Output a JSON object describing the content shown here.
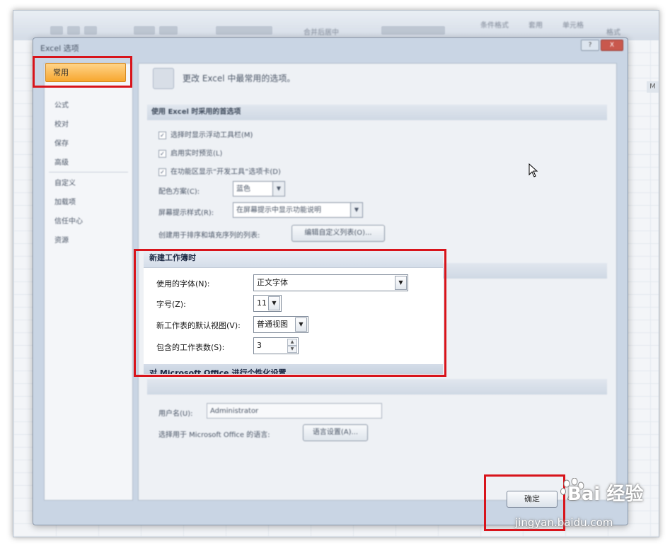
{
  "window": {
    "title": "Excel 选项",
    "minimize_label": "?",
    "close_label": "X"
  },
  "ribbon": {
    "buttons": [
      "条件格式",
      "套用",
      "单元格",
      "格式",
      "合并后居中"
    ],
    "column_header": "M"
  },
  "sidebar": {
    "selected": "常用",
    "items": [
      {
        "label": "公式"
      },
      {
        "label": "校对"
      },
      {
        "label": "保存"
      },
      {
        "label": "高级"
      },
      {
        "label": "自定义"
      },
      {
        "label": "加载项"
      },
      {
        "label": "信任中心"
      },
      {
        "label": "资源"
      }
    ]
  },
  "main": {
    "header": "更改 Excel 中最常用的选项。",
    "section_top": {
      "title": "使用 Excel 时采用的首选项",
      "checkboxes": [
        {
          "label": "选择时显示浮动工具栏(M)",
          "checked": true
        },
        {
          "label": "启用实时预览(L)",
          "checked": true
        },
        {
          "label": "在功能区显示“开发工具”选项卡(D)",
          "checked": true
        }
      ],
      "color_scheme_label": "配色方案(C):",
      "color_scheme_value": "蓝色",
      "screentip_label": "屏幕提示样式(R):",
      "screentip_value": "在屏幕提示中显示功能说明",
      "custom_lists_label": "创建用于排序和填充序列的列表:",
      "custom_lists_button": "编辑自定义列表(O)..."
    },
    "new_workbook": {
      "title": "新建工作簿时",
      "font_label": "使用的字体(N):",
      "font_value": "正文字体",
      "size_label": "字号(Z):",
      "size_value": "11",
      "view_label": "新工作表的默认视图(V):",
      "view_value": "普通视图",
      "sheets_label": "包含的工作表数(S):",
      "sheets_value": "3"
    },
    "personalize": {
      "title": "对 Microsoft Office 进行个性化设置",
      "username_label": "用户名(U):",
      "username_value": "Administrator",
      "language_label": "选择用于 Microsoft Office 的语言:",
      "language_button": "语言设置(A)..."
    }
  },
  "footer": {
    "ok_label": "确定"
  },
  "watermark": {
    "brand": "Bai 经验",
    "url": "jingyan.baidu.com"
  },
  "colors": {
    "highlight": "#d8141b",
    "selected_nav": "#f7a72f"
  }
}
